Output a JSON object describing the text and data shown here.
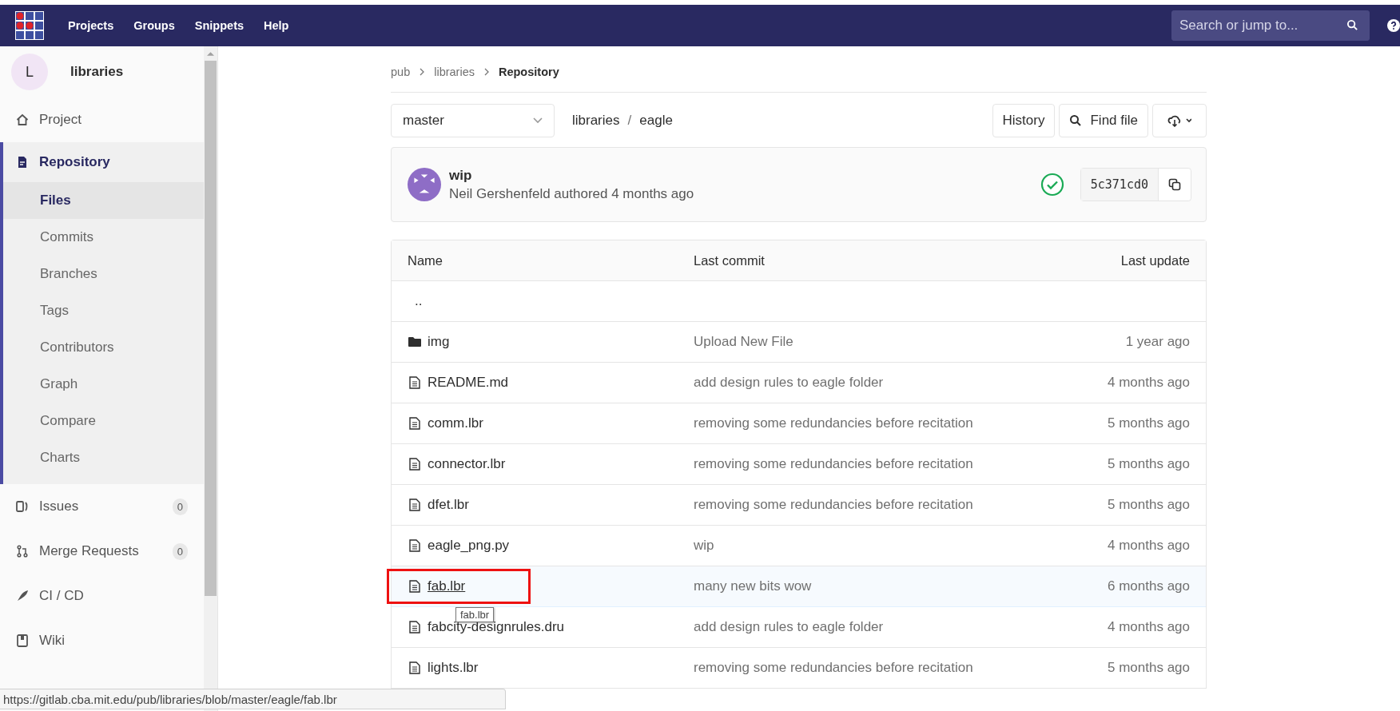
{
  "top_nav": {
    "links": [
      {
        "label": "Projects"
      },
      {
        "label": "Groups"
      },
      {
        "label": "Snippets"
      },
      {
        "label": "Help"
      }
    ],
    "search": {
      "placeholder": "Search or jump to..."
    }
  },
  "sidebar": {
    "project": {
      "avatar_letter": "L",
      "name": "libraries"
    },
    "items": [
      {
        "label": "Project",
        "selected": false
      },
      {
        "label": "Repository",
        "selected": true,
        "children": [
          {
            "label": "Files",
            "selected": true
          },
          {
            "label": "Commits",
            "selected": false
          },
          {
            "label": "Branches",
            "selected": false
          },
          {
            "label": "Tags",
            "selected": false
          },
          {
            "label": "Contributors",
            "selected": false
          },
          {
            "label": "Graph",
            "selected": false
          },
          {
            "label": "Compare",
            "selected": false
          },
          {
            "label": "Charts",
            "selected": false
          }
        ]
      },
      {
        "label": "Issues",
        "selected": false,
        "count": "0"
      },
      {
        "label": "Merge Requests",
        "selected": false,
        "count": "0"
      },
      {
        "label": "CI / CD",
        "selected": false
      },
      {
        "label": "Wiki",
        "selected": false
      }
    ]
  },
  "breadcrumb": [
    "pub",
    "libraries",
    "Repository"
  ],
  "toolbar": {
    "branch": "master",
    "path": [
      "libraries",
      "eagle"
    ],
    "path_separator": "/",
    "buttons": [
      "History",
      "Find file"
    ]
  },
  "commit": {
    "title": "wip",
    "meta": "Neil Gershenfeld authored 4 months ago",
    "pipeline_passed": true,
    "sha": "5c371cd0"
  },
  "table": {
    "columns": [
      "Name",
      "Last commit",
      "Last update"
    ],
    "rows": [
      {
        "kind": "parent",
        "name": "..",
        "hovered": false,
        "highlighted": false
      },
      {
        "kind": "folder",
        "name": "img",
        "commit": "Upload New File",
        "updated": "1 year ago",
        "hovered": false,
        "highlighted": false
      },
      {
        "kind": "file",
        "name": "README.md",
        "commit": "add design rules to eagle folder",
        "updated": "4 months ago",
        "hovered": false,
        "highlighted": false
      },
      {
        "kind": "file",
        "name": "comm.lbr",
        "commit": "removing some redundancies before recitation",
        "updated": "5 months ago",
        "hovered": false,
        "highlighted": false
      },
      {
        "kind": "file",
        "name": "connector.lbr",
        "commit": "removing some redundancies before recitation",
        "updated": "5 months ago",
        "hovered": false,
        "highlighted": false
      },
      {
        "kind": "file",
        "name": "dfet.lbr",
        "commit": "removing some redundancies before recitation",
        "updated": "5 months ago",
        "hovered": false,
        "highlighted": false
      },
      {
        "kind": "file",
        "name": "eagle_png.py",
        "commit": "wip",
        "updated": "4 months ago",
        "hovered": false,
        "highlighted": false
      },
      {
        "kind": "file",
        "name": "fab.lbr",
        "commit": "many new bits wow",
        "updated": "6 months ago",
        "hovered": true,
        "highlighted": true,
        "tooltip": "fab.lbr"
      },
      {
        "kind": "file",
        "name": "fabcity-designrules.dru",
        "commit": "add design rules to eagle folder",
        "updated": "4 months ago",
        "hovered": false,
        "highlighted": false
      },
      {
        "kind": "file",
        "name": "lights.lbr",
        "commit": "removing some redundancies before recitation",
        "updated": "5 months ago",
        "hovered": false,
        "highlighted": false
      }
    ]
  },
  "status_url": "https://gitlab.cba.mit.edu/pub/libraries/blob/master/eagle/fab.lbr"
}
